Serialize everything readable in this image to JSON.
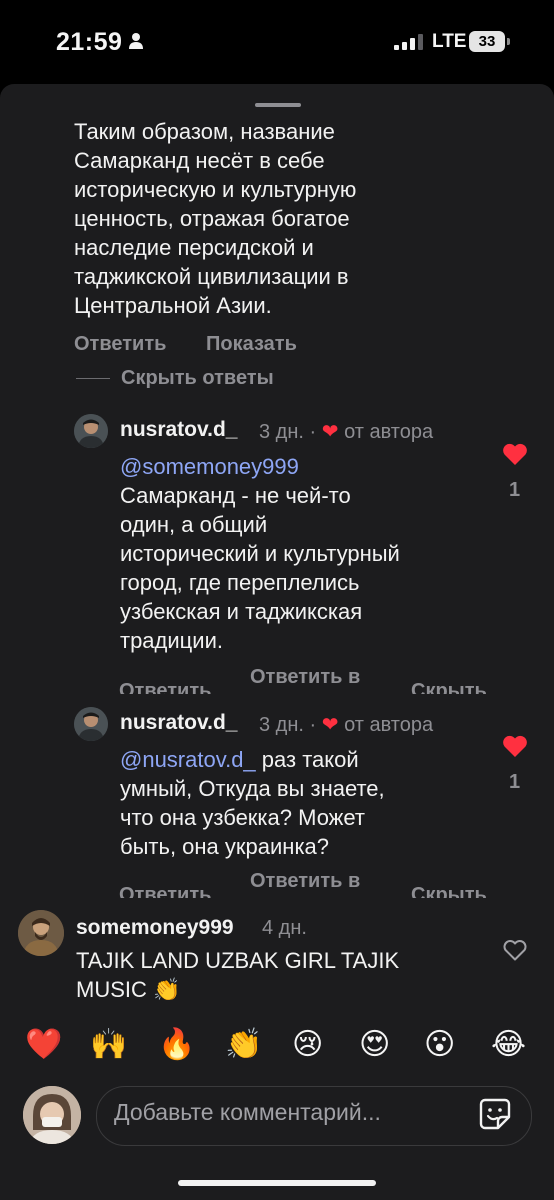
{
  "status_bar": {
    "time": "21:59",
    "network": "LTE",
    "battery": "33"
  },
  "thread": {
    "text": "Таким образом, название\nСамарканд несёт в себе\nисторическую и культурную\nценность, отражая богатое\nнаследие персидской и\nтаджикской цивилизации в\nЦентральной Азии.",
    "reply_label": "Ответить",
    "show_label": "Показать",
    "hide_replies_label": "Скрыть ответы"
  },
  "replies": [
    {
      "username": "nusratov.d_",
      "age": "3 дн.",
      "dot": "·",
      "author_badge": "от автора",
      "mention": "@somemoney999",
      "text": "Самарканд - не чей-то\nодин, а общий\nисторический и культурный\nгород, где переплелись\nузбекская и таджикская\nтрадиции.",
      "likes": "1",
      "action_reply": "Ответить",
      "action_reply_in": "Ответить в",
      "action_hide": "Скрыть"
    },
    {
      "username": "nusratov.d_",
      "age": "3 дн.",
      "dot": "·",
      "author_badge": "от автора",
      "mention": "@nusratov.d_",
      "text_first": " раз такой",
      "text_rest": "умный, Откуда вы знаете,\nчто она узбекка? Может\nбыть, она украинка?",
      "likes": "1",
      "action_reply": "Ответить",
      "action_reply_in": "Ответить в",
      "action_hide": "Скрыть"
    }
  ],
  "comment": {
    "username": "somemoney999",
    "age": "4 дн.",
    "text": "TAJIK LAND UZBAK GIRL TAJIK\nMUSIC 👏"
  },
  "reactions": [
    "❤️",
    "🙌",
    "🔥",
    "👏",
    "😢",
    "😍",
    "😮",
    "😂"
  ],
  "composer": {
    "placeholder": "Добавьте комментарий..."
  },
  "colors": {
    "background": "#1c1c1e",
    "text": "#f2f2f2",
    "muted": "#8e8e93",
    "mention": "#8ea6f5",
    "like": "#ff3040"
  },
  "icons": [
    "person-icon",
    "signal-icon",
    "battery-icon",
    "heart-icon",
    "heart-outline-icon",
    "sticker-icon"
  ]
}
